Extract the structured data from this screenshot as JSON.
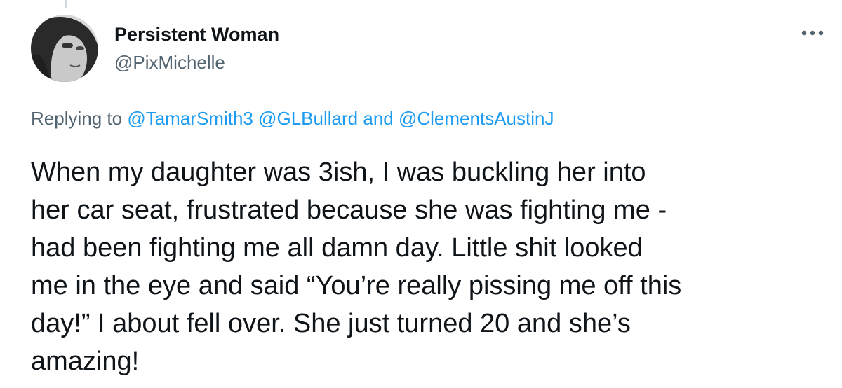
{
  "tweet": {
    "author": {
      "display_name": "Persistent Woman",
      "handle": "@PixMichelle"
    },
    "more_icon": "ellipsis-icon",
    "reply_context": {
      "prefix": "Replying to",
      "mentions": [
        "@TamarSmith3",
        "@GLBullard"
      ],
      "conjunction": "and",
      "last_mention": "@ClementsAustinJ"
    },
    "text_lines": [
      "When my daughter was 3ish, I was buckling her into",
      "her car seat, frustrated because she was fighting me -",
      "had been fighting me all damn day. Little shit looked",
      "me in the eye and said “You’re really pissing me off this",
      "day!” I about fell over. She just turned 20 and she’s",
      "amazing!"
    ]
  },
  "colors": {
    "text": "#0f1419",
    "secondary": "#536471",
    "link": "#1d9bf0",
    "thread_line": "#cfd9de"
  }
}
